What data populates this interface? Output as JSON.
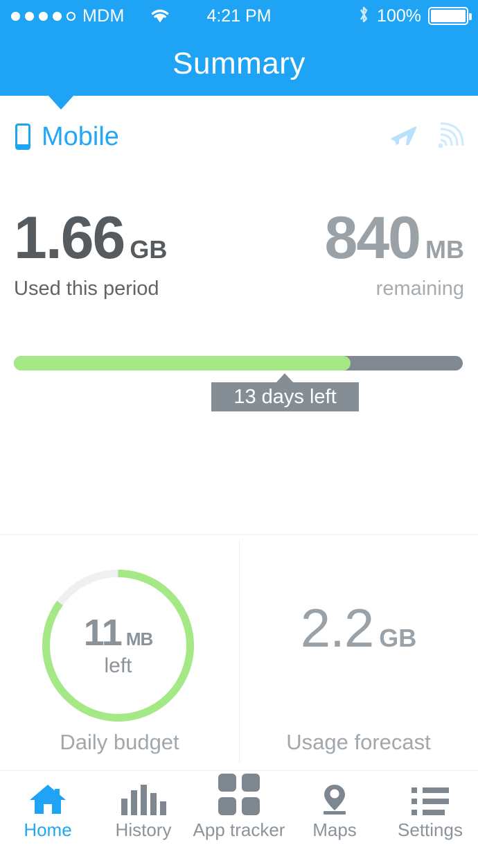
{
  "status_bar": {
    "signal_dots_filled": 4,
    "signal_dots_total": 5,
    "carrier": "MDM",
    "wifi_icon": "wifi-icon",
    "time": "4:21 PM",
    "bluetooth_icon": "bluetooth-icon",
    "battery_percent": "100%",
    "battery_icon": "battery-full-icon"
  },
  "header": {
    "title": "Summary"
  },
  "connection": {
    "icon": "mobile-phone-icon",
    "label": "Mobile",
    "airplane_icon": "airplane-icon",
    "roaming_icon": "roaming-signal-icon"
  },
  "usage": {
    "used_value": "1.66",
    "used_unit": "GB",
    "used_caption": "Used this period",
    "remaining_value": "840",
    "remaining_unit": "MB",
    "remaining_caption": "remaining",
    "progress_percent": 75,
    "tooltip": "13 days left"
  },
  "daily_budget": {
    "value": "11",
    "unit": "MB",
    "sub": "left",
    "caption": "Daily budget",
    "arc_percent": 85
  },
  "forecast": {
    "value": "2.2",
    "unit": "GB",
    "caption": "Usage forecast"
  },
  "tabs": [
    {
      "label": "Home",
      "icon": "home-icon",
      "active": true
    },
    {
      "label": "History",
      "icon": "bar-chart-icon",
      "active": false
    },
    {
      "label": "App tracker",
      "icon": "grid-apps-icon",
      "active": false
    },
    {
      "label": "Maps",
      "icon": "map-pin-icon",
      "active": false
    },
    {
      "label": "Settings",
      "icon": "list-icon",
      "active": false
    }
  ],
  "colors": {
    "accent_blue": "#1fa4f5",
    "link_blue": "#22a7f7",
    "green": "#a4e986",
    "track_gray": "#808892",
    "text_dark": "#555b5f",
    "text_gray": "#9aa1a7"
  },
  "chart_data": [
    {
      "type": "bar",
      "title": "Data usage progress",
      "categories": [
        "used",
        "remaining"
      ],
      "values": [
        75,
        25
      ],
      "annotations": [
        "13 days left"
      ],
      "ylabel": "",
      "xlabel": ""
    },
    {
      "type": "pie",
      "title": "Daily budget",
      "categories": [
        "remaining",
        "used"
      ],
      "values": [
        85,
        15
      ],
      "center_label": "11 MB left"
    }
  ]
}
